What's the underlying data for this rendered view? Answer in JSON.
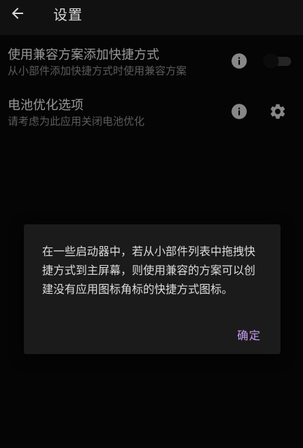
{
  "toolbar": {
    "title": "设置"
  },
  "preferences": [
    {
      "title": "使用兼容方案添加快捷方式",
      "summary": "从小部件添加快捷方式时使用兼容方案",
      "toggle_on": false
    },
    {
      "title": "电池优化选项",
      "summary": "请考虑为此应用关闭电池优化"
    }
  ],
  "dialog": {
    "message": "在一些启动器中，若从小部件列表中拖拽快捷方式到主屏幕，则使用兼容的方案可以创建没有应用图标角标的快捷方式图标。",
    "ok_label": "确定"
  },
  "colors": {
    "accent": "#c79bf2",
    "background": "#090909",
    "dialog": "#1b1b1b"
  },
  "icons": {
    "back": "arrow-back-icon",
    "info": "info-icon",
    "settings": "gear-icon"
  }
}
